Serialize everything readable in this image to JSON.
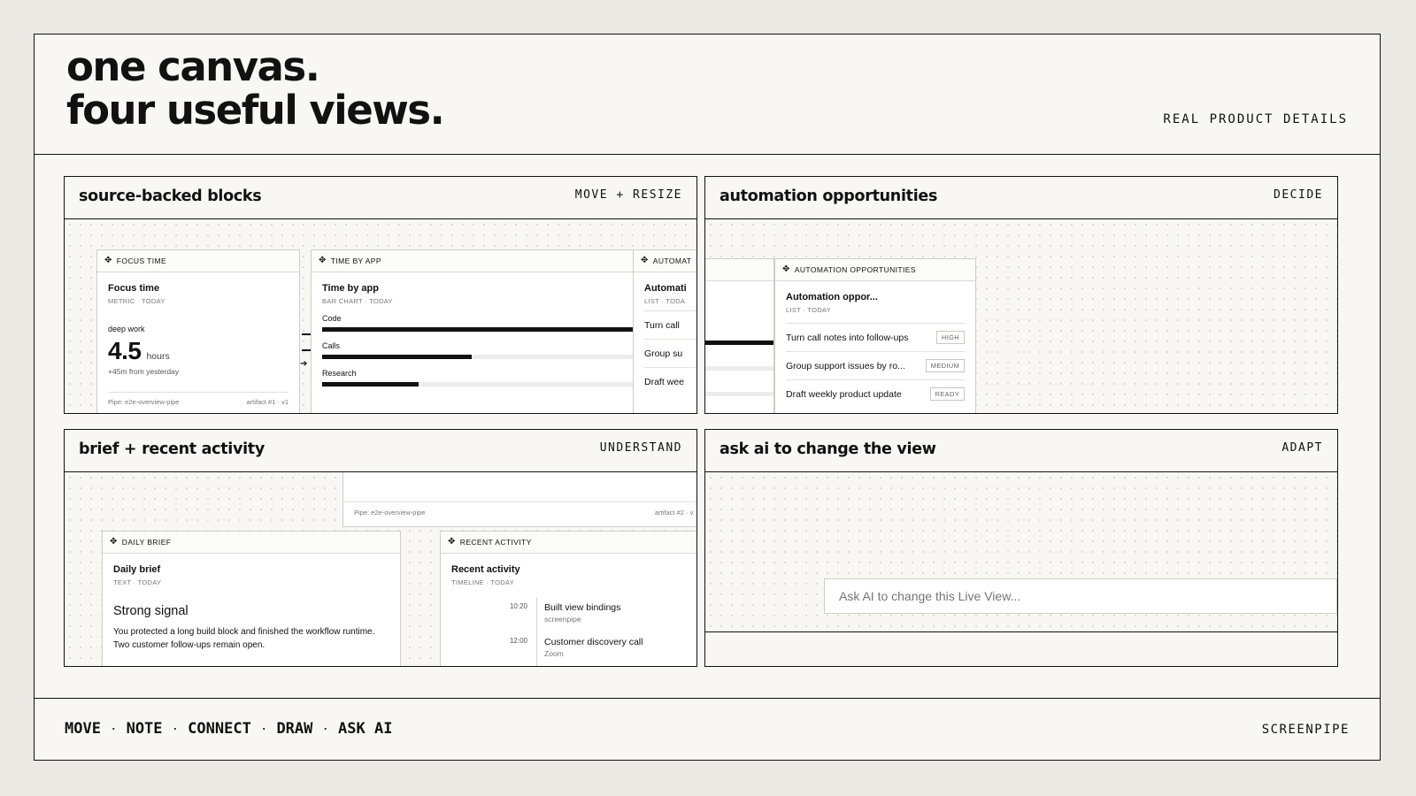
{
  "header": {
    "headline_line1": "one canvas.",
    "headline_line2": "four useful views.",
    "kicker": "REAL PRODUCT DETAILS"
  },
  "panels": {
    "blocks": {
      "title": "source-backed blocks",
      "tag": "MOVE + RESIZE",
      "focus": {
        "bar": "FOCUS TIME",
        "title": "Focus time",
        "sub": "METRIC · TODAY",
        "label": "deep work",
        "value": "4.5",
        "unit": "hours",
        "delta": "+45m from yesterday",
        "pipe": "Pipe: e2e-overview-pipe",
        "artifact": "artifact #1 · v1"
      },
      "timebyapp": {
        "bar": "TIME BY APP",
        "title": "Time by app",
        "sub": "BAR CHART · TODAY",
        "rows": [
          {
            "label": "Code",
            "fraction": 1.0
          },
          {
            "label": "Calls",
            "fraction": 0.48
          },
          {
            "label": "Research",
            "fraction": 0.31
          }
        ]
      },
      "automation_peek": {
        "bar": "AUTOMAT",
        "title": "Automati",
        "sub": "LIST · TODA",
        "rows": [
          "Turn call",
          "Group su",
          "Draft wee"
        ]
      }
    },
    "automation": {
      "title": "automation opportunities",
      "tag": "DECIDE",
      "card": {
        "bar": "AUTOMATION OPPORTUNITIES",
        "title": "Automation oppor...",
        "sub": "LIST · TODAY",
        "rows": [
          {
            "label": "Turn call notes into follow-ups",
            "badge": "HIGH"
          },
          {
            "label": "Group support issues by ro...",
            "badge": "MEDIUM"
          },
          {
            "label": "Draft weekly product update",
            "badge": "READY"
          }
        ]
      }
    },
    "brief": {
      "title": "brief + recent activity",
      "tag": "UNDERSTAND",
      "pipe_card": {
        "pipe": "Pipe: e2e-overview-pipe",
        "artifact": "artifact #2 · v"
      },
      "daily": {
        "bar": "DAILY BRIEF",
        "title": "Daily brief",
        "sub": "TEXT · TODAY",
        "heading": "Strong signal",
        "body": "You protected a long build block and finished the workflow runtime. Two customer follow-ups remain open."
      },
      "recent": {
        "bar": "RECENT ACTIVITY",
        "title": "Recent activity",
        "sub": "TIMELINE · TODAY",
        "items": [
          {
            "time": "10:20",
            "title": "Built view bindings",
            "app": "screenpipe"
          },
          {
            "time": "12:00",
            "title": "Customer discovery call",
            "app": "Zoom"
          }
        ]
      }
    },
    "ask": {
      "title": "ask ai to change the view",
      "tag": "ADAPT",
      "placeholder": "Ask AI to change this Live View..."
    }
  },
  "footer": {
    "items": [
      "MOVE",
      "NOTE",
      "CONNECT",
      "DRAW",
      "ASK AI"
    ],
    "separator": "·",
    "brand": "SCREENPIPE"
  }
}
